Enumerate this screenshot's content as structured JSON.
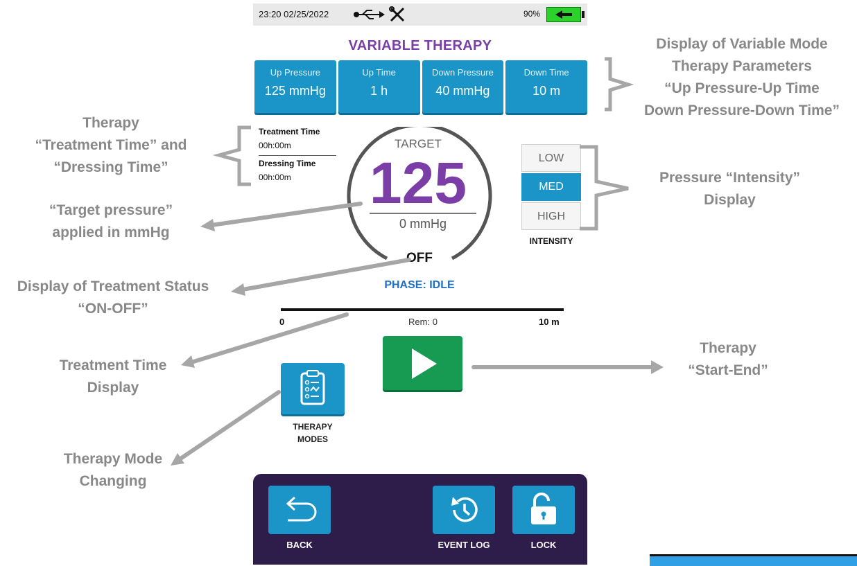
{
  "status_bar": {
    "datetime": "23:20 02/25/2022",
    "battery_percent": "90%",
    "usb_icon": "usb-icon",
    "tools_icon": "tools-icon",
    "battery_icon": "battery-charging-icon"
  },
  "screen": {
    "title": "VARIABLE THERAPY",
    "params": [
      {
        "label": "Up Pressure",
        "value": "125 mmHg"
      },
      {
        "label": "Up Time",
        "value": "1 h"
      },
      {
        "label": "Down Pressure",
        "value": "40 mmHg"
      },
      {
        "label": "Down Time",
        "value": "10 m"
      }
    ],
    "treatment_time": {
      "label": "Treatment Time",
      "value": "00h:00m"
    },
    "dressing_time": {
      "label": "Dressing Time",
      "value": "00h:00m"
    },
    "target": {
      "label": "TARGET",
      "value": "125",
      "current": "0 mmHg"
    },
    "status": "OFF",
    "phase": "PHASE: IDLE",
    "intensity": {
      "options": [
        "LOW",
        "MED",
        "HIGH"
      ],
      "selected": "MED",
      "caption": "INTENSITY"
    },
    "progress": {
      "start": "0",
      "remaining": "Rem: 0",
      "end": "10 m",
      "fraction": 0
    },
    "play_icon": "play-icon",
    "modes": {
      "icon": "clipboard-icon",
      "caption_line1": "THERAPY",
      "caption_line2": "MODES"
    },
    "bottom_nav": [
      {
        "label": "BACK",
        "icon": "back-arrow-icon"
      },
      {
        "label": "EVENT LOG",
        "icon": "history-icon"
      },
      {
        "label": "LOCK",
        "icon": "unlock-icon"
      }
    ]
  },
  "annotations": {
    "params_display": [
      "Display of Variable Mode",
      "Therapy Parameters",
      "“Up Pressure-Up Time",
      "Down Pressure-Down Time”"
    ],
    "therapy_times": [
      "Therapy",
      "“Treatment Time” and",
      "“Dressing Time”"
    ],
    "target_pressure": [
      "“Target pressure”",
      "applied in mmHg"
    ],
    "treatment_status": [
      "Display of Treatment Status",
      "“ON-OFF”"
    ],
    "treatment_time_display": [
      "Treatment Time",
      "Display"
    ],
    "intensity_display": [
      "Pressure “Intensity”",
      "Display"
    ],
    "start_end": [
      "Therapy",
      "“Start-End”"
    ],
    "mode_changing": [
      "Therapy Mode",
      "Changing"
    ]
  },
  "colors": {
    "accent_blue": "#1b95c7",
    "title_purple": "#7a3ea6",
    "play_green": "#179a52",
    "nav_dark": "#2e1c4a",
    "annotation_gray": "#888888"
  }
}
